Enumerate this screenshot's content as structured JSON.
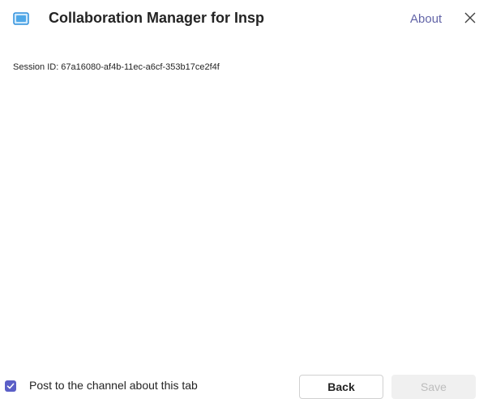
{
  "header": {
    "app_icon": "teams-tab-app-icon",
    "title": "Collaboration Manager for Insp",
    "about_label": "About",
    "close_icon": "close-icon"
  },
  "body": {
    "session_text": "Session ID: 67a16080-af4b-11ec-a6cf-353b17ce2f4f"
  },
  "footer": {
    "post_checkbox_checked": true,
    "post_checkbox_label": "Post to the channel about this tab",
    "back_label": "Back",
    "save_label": "Save",
    "save_disabled": true
  },
  "colors": {
    "accent": "#5b5fc7",
    "link": "#6264a7",
    "app_icon": "#4fa8e8"
  }
}
